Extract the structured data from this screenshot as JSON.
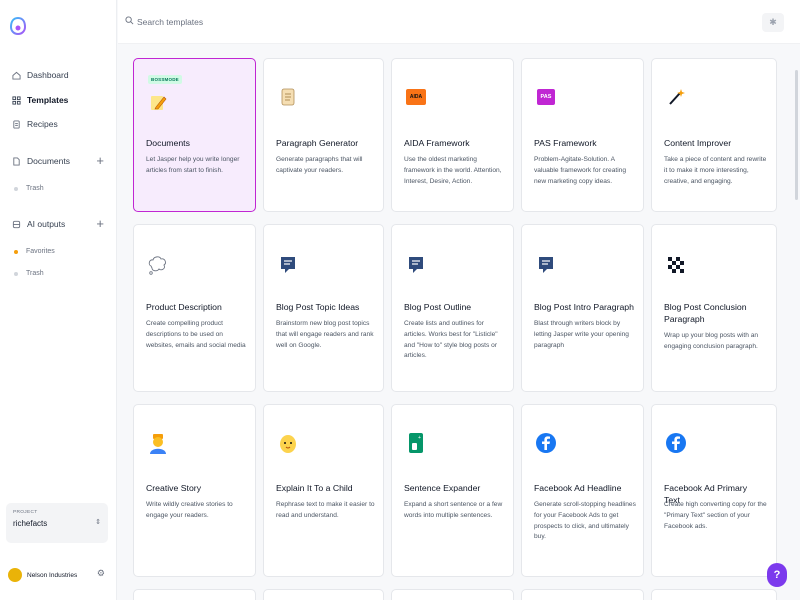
{
  "search": {
    "placeholder": "Search templates"
  },
  "sidebar": {
    "nav": [
      {
        "label": "Dashboard",
        "icon": "home-icon"
      },
      {
        "label": "Templates",
        "icon": "grid-icon"
      },
      {
        "label": "Recipes",
        "icon": "recipe-icon"
      }
    ],
    "documents": {
      "label": "Documents",
      "trash": "Trash"
    },
    "ai_outputs": {
      "label": "AI outputs",
      "favorites": "Favorites",
      "trash": "Trash"
    },
    "project": {
      "label": "PROJECT",
      "name": "richefacts"
    },
    "org": {
      "name": "Nelson Industries"
    }
  },
  "help_label": "?",
  "cards": [
    {
      "title": "Documents",
      "badge": "BOSSMODE",
      "desc": "Let Jasper help you write longer articles from start to finish.",
      "icon": "pencil-icon"
    },
    {
      "title": "Paragraph Generator",
      "desc": "Generate paragraphs that will captivate your readers.",
      "icon": "scroll-icon"
    },
    {
      "title": "AIDA Framework",
      "desc": "Use the oldest marketing framework in the world. Attention, Interest, Desire, Action.",
      "icon": "aida-icon",
      "icon_text": "AIDA"
    },
    {
      "title": "PAS Framework",
      "desc": "Problem-Agitate-Solution. A valuable framework for creating new marketing copy ideas.",
      "icon": "pas-icon",
      "icon_text": "PAS"
    },
    {
      "title": "Content Improver",
      "desc": "Take a piece of content and rewrite it to make it more interesting, creative, and engaging.",
      "icon": "magic-wand-icon"
    },
    {
      "title": "Product Description",
      "desc": "Create compelling product descriptions to be used on websites, emails and social media",
      "icon": "thought-bubble-icon"
    },
    {
      "title": "Blog Post Topic Ideas",
      "desc": "Brainstorm new blog post topics that will engage readers and rank well on Google.",
      "icon": "chat-icon"
    },
    {
      "title": "Blog Post Outline",
      "desc": "Create lists and outlines for articles. Works best for \"Listicle\" and \"How to\" style blog posts or articles.",
      "icon": "chat-icon"
    },
    {
      "title": "Blog Post Intro Paragraph",
      "desc": "Blast through writers block by letting Jasper write your opening paragraph",
      "icon": "chat-icon"
    },
    {
      "title": "Blog Post Conclusion Paragraph",
      "desc": "Wrap up your blog posts with an engaging conclusion paragraph.",
      "icon": "checkered-flag-icon"
    },
    {
      "title": "Creative Story",
      "desc": "Write wildly creative stories to engage your readers.",
      "icon": "storyteller-icon"
    },
    {
      "title": "Explain It To a Child",
      "desc": "Rephrase text to make it easier to read and understand.",
      "icon": "baby-icon"
    },
    {
      "title": "Sentence Expander",
      "desc": "Expand a short sentence or a few words into multiple sentences.",
      "icon": "expander-icon"
    },
    {
      "title": "Facebook Ad Headline",
      "desc": "Generate scroll-stopping headlines for your Facebook Ads to get prospects to click, and ultimately buy.",
      "icon": "facebook-icon"
    },
    {
      "title": "Facebook Ad Primary Text",
      "desc": "Create high converting copy for the \"Primary Text\" section of your Facebook ads.",
      "icon": "facebook-icon"
    }
  ],
  "colors": {
    "accent": "#c026d3",
    "selected_bg": "#f7ecfd",
    "help": "#7c3aed",
    "facebook": "#1877f2"
  }
}
